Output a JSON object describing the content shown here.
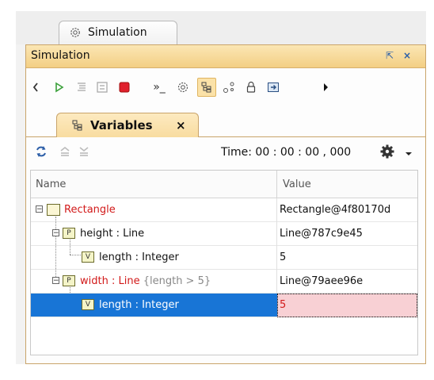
{
  "outer_tab": {
    "label": "Simulation",
    "icon": "simulation-gear-icon"
  },
  "panel": {
    "title": "Simulation",
    "restore_icon": "restore-icon",
    "close_icon": "close-icon"
  },
  "toolbar": {
    "buttons": [
      "step-back-icon",
      "run-icon",
      "step-into-icon",
      "step-over-icon",
      "terminate-icon",
      "console-icon",
      "gear-icon",
      "variables-icon",
      "breakpoints-icon",
      "lock-icon",
      "export-icon",
      "more-icon"
    ]
  },
  "inner_tab": {
    "label": "Variables",
    "icon": "variables-icon",
    "close": "×"
  },
  "vtoolbar": {
    "time_text": "Time: 00 : 00 : 00 , 000"
  },
  "grid": {
    "columns": [
      "Name",
      "Value"
    ],
    "rows": [
      {
        "name": "Rectangle",
        "value": "Rectangle@4f80170d"
      },
      {
        "name": "height : Line",
        "value": "Line@787c9e45"
      },
      {
        "name": "length : Integer",
        "value": "5"
      },
      {
        "name": "width : Line",
        "constraint": "{length > 5}",
        "value": "Line@79aee96e"
      },
      {
        "name": "length : Integer",
        "value": "5"
      }
    ]
  }
}
